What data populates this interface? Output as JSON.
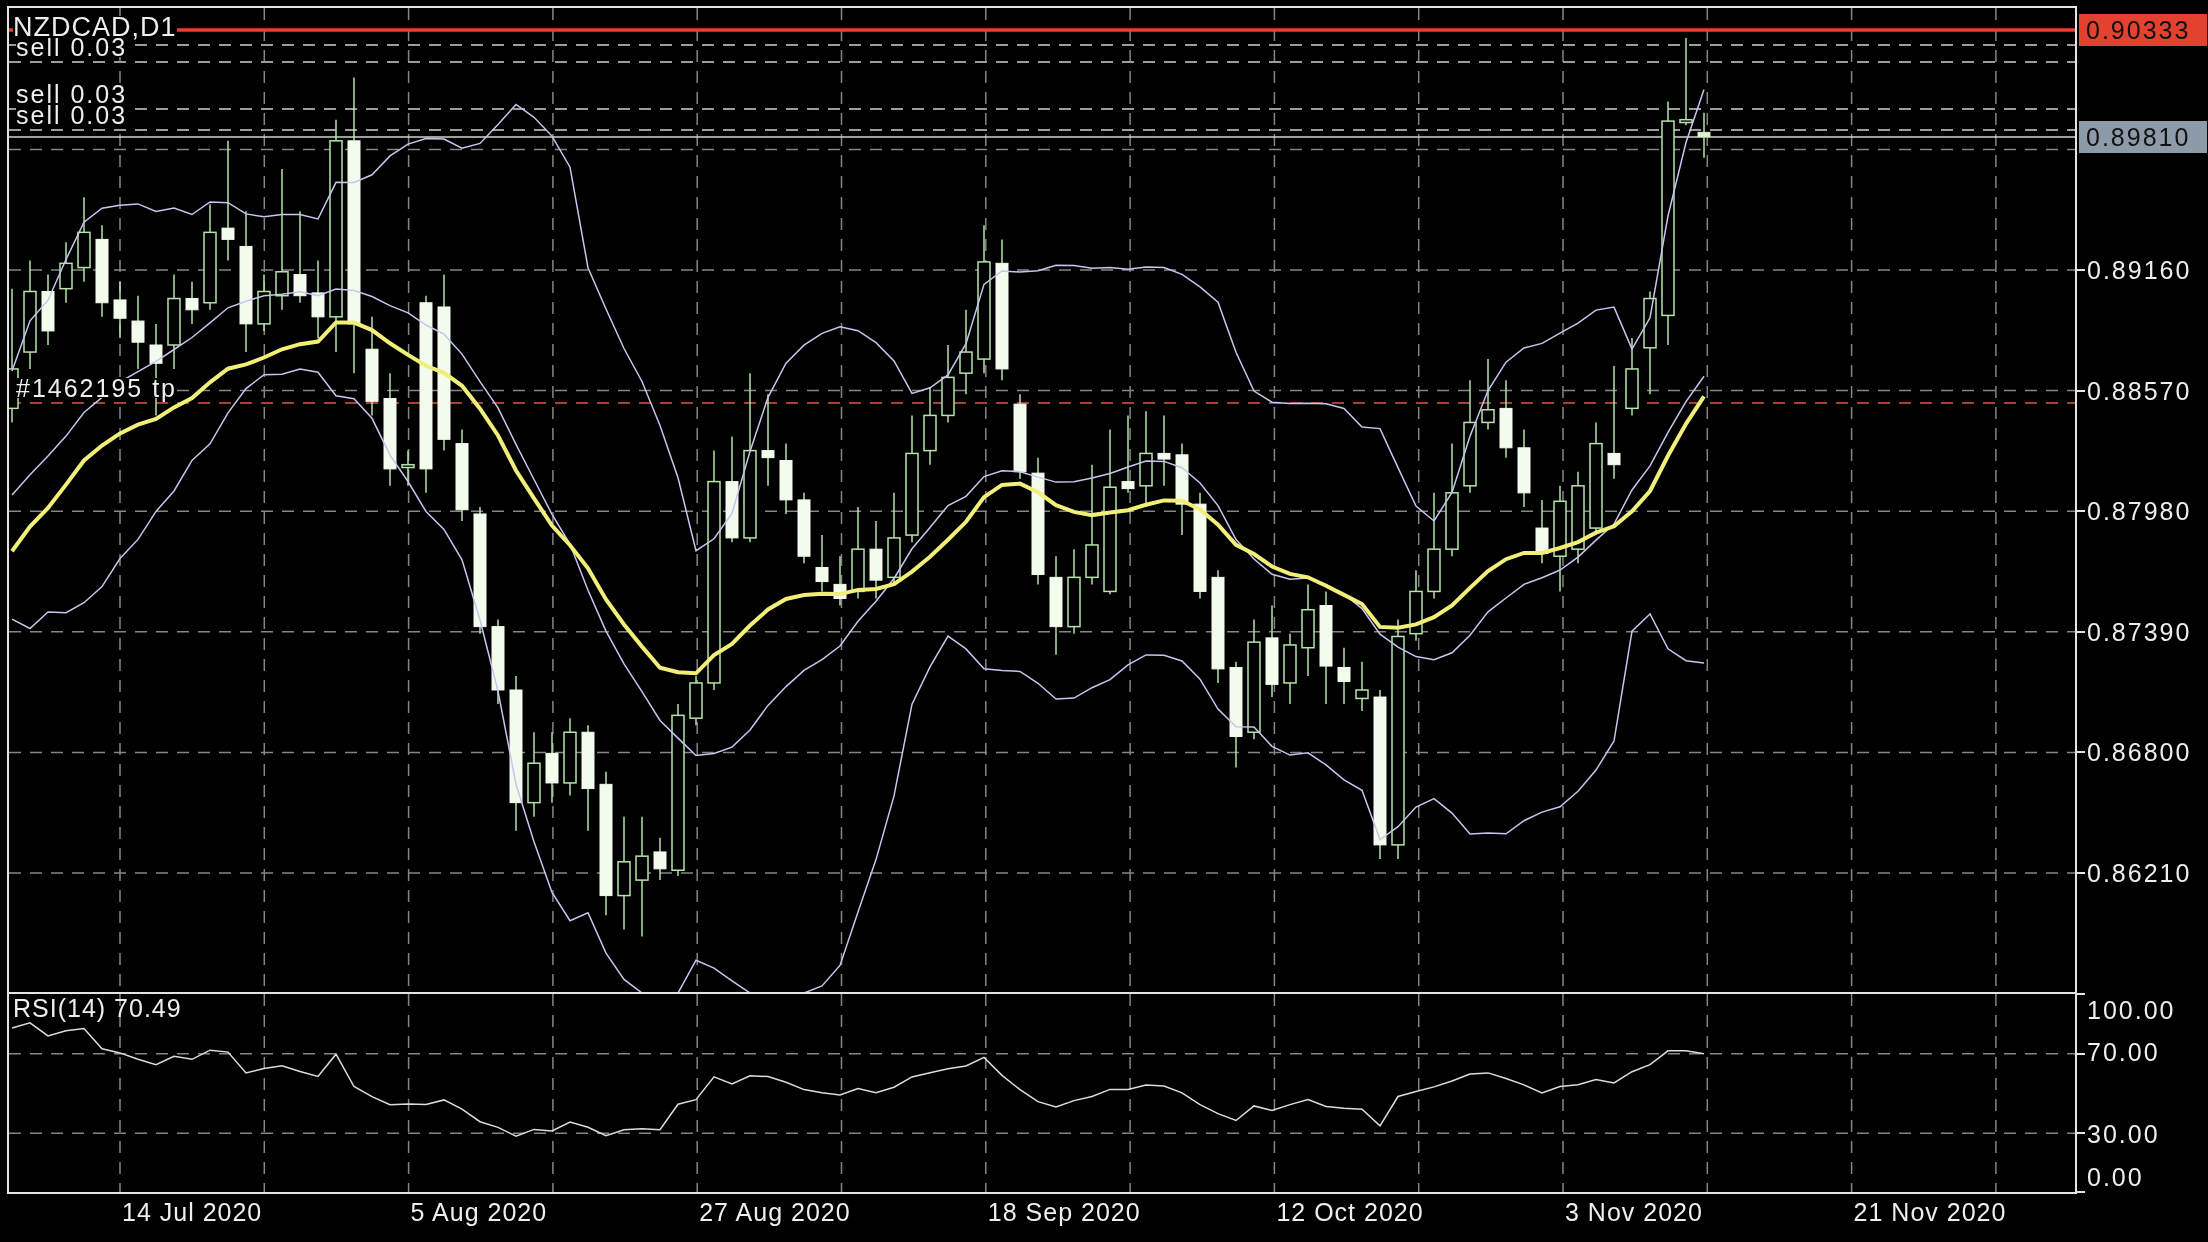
{
  "chart": {
    "title": "NZDCAD,D1"
  },
  "order_lines": [
    {
      "kind": "sell"
    },
    {
      "kind": "sell",
      "label": "sell 0.03"
    },
    {
      "kind": "sell",
      "label": "sell 0.03"
    },
    {
      "kind": "sell",
      "label": "sell 0.03"
    },
    {
      "kind": "take_profit",
      "label": "#1462195 tp"
    }
  ],
  "price_tags": [
    {
      "kind": "level",
      "text": "0.90333",
      "color": "#e4412e"
    },
    {
      "kind": "bid",
      "text": "0.89810",
      "color": "#8d9aa9"
    }
  ],
  "price_axis": {
    "labels": [
      "0.89160",
      "0.88570",
      "0.87980",
      "0.87390",
      "0.86800",
      "0.86210"
    ]
  },
  "rsi_panel": {
    "label": "RSI(14) 70.49",
    "axis_labels": [
      "100.00",
      "70.00",
      "30.00",
      "0.00"
    ]
  },
  "time_axis": {
    "labels": [
      "14 Jul 2020",
      "5 Aug 2020",
      "27 Aug 2020",
      "18 Sep 2020",
      "12 Oct 2020",
      "3 Nov 2020",
      "21 Nov 2020"
    ]
  }
}
